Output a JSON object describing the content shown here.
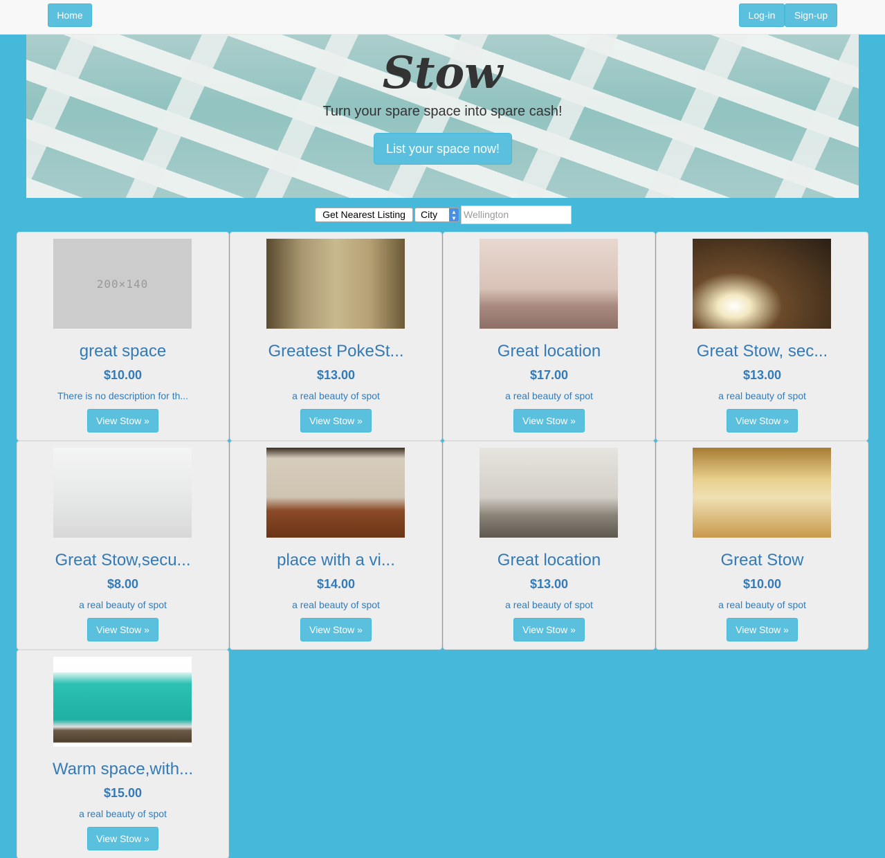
{
  "nav": {
    "home_label": "Home",
    "login_label": "Log-in",
    "signup_label": "Sign-up"
  },
  "hero": {
    "logo_text": "Stow",
    "tagline": "Turn your spare space into spare cash!",
    "cta_label": "List your space now!"
  },
  "search": {
    "nearest_label": "Get Nearest Listing",
    "city_selected": "City",
    "city_placeholder": "Wellington"
  },
  "listings": [
    {
      "title": "great space",
      "price": "$10.00",
      "description": "There is no description for th...",
      "button": "View Stow »",
      "image": "placeholder-200x140",
      "placeholder_text": "200×140"
    },
    {
      "title": "Greatest PokeSt...",
      "price": "$13.00",
      "description": "a real beauty of spot",
      "button": "View Stow »",
      "image": "room-arched-windows"
    },
    {
      "title": "Great location",
      "price": "$17.00",
      "description": "a real beauty of spot",
      "button": "View Stow »",
      "image": "room-pink-ceiling-fan"
    },
    {
      "title": "Great Stow, sec...",
      "price": "$13.00",
      "description": "a real beauty of spot",
      "button": "View Stow »",
      "image": "room-dark-sunlit-floor"
    },
    {
      "title": "Great Stow,secu...",
      "price": "$8.00",
      "description": "a real beauty of spot",
      "button": "View Stow »",
      "image": "room-white-empty"
    },
    {
      "title": "place with a vi...",
      "price": "$14.00",
      "description": "a real beauty of spot",
      "button": "View Stow »",
      "image": "room-parquet-floor"
    },
    {
      "title": "Great location",
      "price": "$13.00",
      "description": "a real beauty of spot",
      "button": "View Stow »",
      "image": "room-grey-carpet"
    },
    {
      "title": "Great Stow",
      "price": "$10.00",
      "description": "a real beauty of spot",
      "button": "View Stow »",
      "image": "room-sea-view"
    },
    {
      "title": "Warm space,with...",
      "price": "$15.00",
      "description": "a real beauty of spot",
      "button": "View Stow »",
      "image": "room-teal-3d"
    }
  ]
}
